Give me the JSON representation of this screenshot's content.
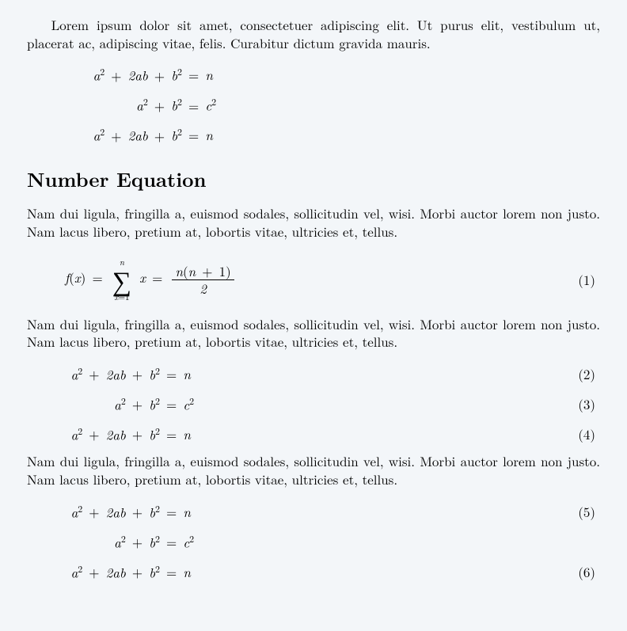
{
  "intro_para": "Lorem ipsum dolor sit amet, consectetuer adipiscing elit. Ut purus elit, vestibulum ut, placerat ac, adipiscing vitae, felis. Curabitur dictum gravida mauris.",
  "heading": "Number Equation",
  "para_nam": "Nam dui ligula, fringilla a, euismod sodales, sollicitudin vel, wisi. Morbi auctor lorem non justo. Nam lacus libero, pretium at, lobortis vitae, ultricies et, tellus.",
  "eq": {
    "binom_lhs_html": "a<sup>2</sup> <span class='op'>+</span> 2ab <span class='op'>+</span> b<sup>2</sup>",
    "binom_rhs_html": "<span class='op'>=</span> n",
    "pyth_lhs_html": "a<sup>2</sup> <span class='op'>+</span> b<sup>2</sup>",
    "pyth_rhs_html": "<span class='op'>=</span> c<sup>2</sup>",
    "sum_upper": "n",
    "sum_lower_html": "x<span class='rm'>=1</span>",
    "sum_fx": "f",
    "sum_arg": "x",
    "sum_term": "x",
    "frac_num_html": "n<span class='rm'>(</span>n <span class='op'>+</span> <span class='rm'>1</span><span class='rm'>)</span>",
    "frac_den": "2"
  },
  "nums": {
    "n1": "(1)",
    "n2": "(2)",
    "n3": "(3)",
    "n4": "(4)",
    "n5": "(5)",
    "n6": "(6)"
  }
}
